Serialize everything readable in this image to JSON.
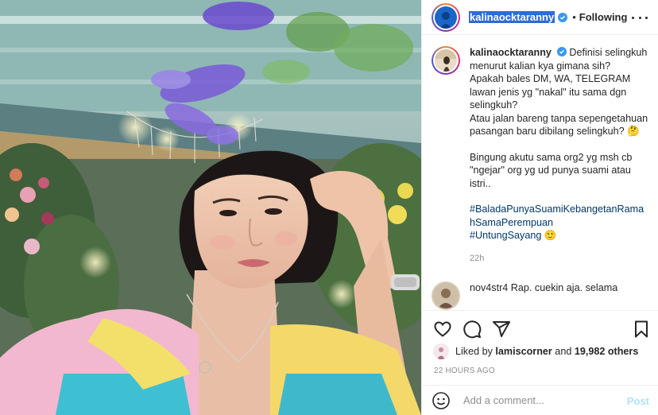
{
  "post": {
    "username": "kalinaocktaranny",
    "follow_status": "Following",
    "more_icon": "more-horizontal-icon"
  },
  "caption": {
    "username": "kalinaocktaranny",
    "paragraphs": [
      "Definisi selingkuh menurut kalian kya gimana sih?",
      "Apakah bales DM, WA, TELEGRAM lawan jenis yg \"nakal\" itu sama dgn selingkuh?",
      "Atau jalan bareng tanpa sepengetahuan pasangan baru dibilang selingkuh? 🤔"
    ],
    "paragraph2": "Bingung akutu sama org2 yg msh cb \"ngejar\" org yg ud punya suami atau istri..",
    "hashtag1": "#BaladaPunyaSuamiKebangetanRamahSamaPerempuan",
    "hashtag2": "#UntungSayang",
    "hashtag2_emoji": "🙂",
    "time": "22h"
  },
  "next_comment": {
    "text": "nov4str4 Rap. cuekin aja. selama"
  },
  "actions": {
    "like_icon": "heart-icon",
    "comment_icon": "comment-icon",
    "share_icon": "send-icon",
    "save_icon": "bookmark-icon"
  },
  "likes": {
    "prefix": "Liked by ",
    "user": "lamiscorner",
    "middle": " and ",
    "count": "19,982 others"
  },
  "timestamp": "22 HOURS AGO",
  "comment_box": {
    "placeholder": "Add a comment...",
    "post_label": "Post",
    "emoji_icon": "smiley-icon"
  },
  "colors": {
    "accent": "#0095f6",
    "post_disabled": "#b2dffc",
    "hashtag": "#00376b",
    "muted": "#8e8e8e",
    "username_highlight": "#2f6bd3"
  }
}
